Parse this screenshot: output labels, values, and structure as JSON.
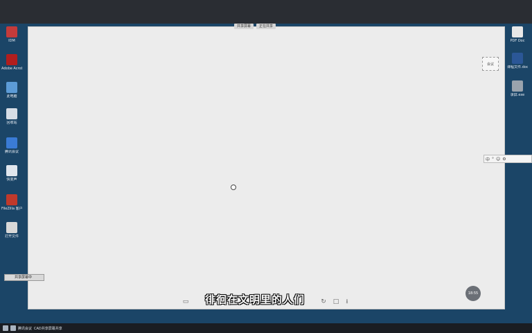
{
  "window": {
    "tabs": [
      "共享屏幕",
      "正在共享"
    ]
  },
  "desktop_left": [
    {
      "label": "IDM",
      "color": "#c43b3b"
    },
    {
      "label": "Adobe Acrobat DC",
      "color": "#b11e1e"
    },
    {
      "label": "此电脑",
      "color": "#5c9bd6"
    },
    {
      "label": "回收站",
      "color": "#d6dde6"
    },
    {
      "label": "腾讯会议",
      "color": "#3a7bd5"
    },
    {
      "label": "快变声",
      "color": "#e0e6ee"
    },
    {
      "label": "FileZilla 客户端",
      "color": "#c0392b"
    },
    {
      "label": "打开文件",
      "color": "#d8d8d8"
    }
  ],
  "desktop_right": [
    {
      "label": "PDF Doc",
      "color": "#e8e8e8"
    },
    {
      "label": "课程文件.docx",
      "color": "#2b5797"
    },
    {
      "label": "录屏.exe",
      "color": "#9aa3ad"
    }
  ],
  "right_widget": "会议",
  "ime": [
    "中",
    "°",
    "☺",
    "⚙"
  ],
  "tooltip": "共享屏幕中",
  "subtitle": "徘徊在文明里的人们",
  "badge": "18:55",
  "taskbar": {
    "items": [
      "腾讯会议",
      "CAD共享屏幕共享"
    ]
  }
}
